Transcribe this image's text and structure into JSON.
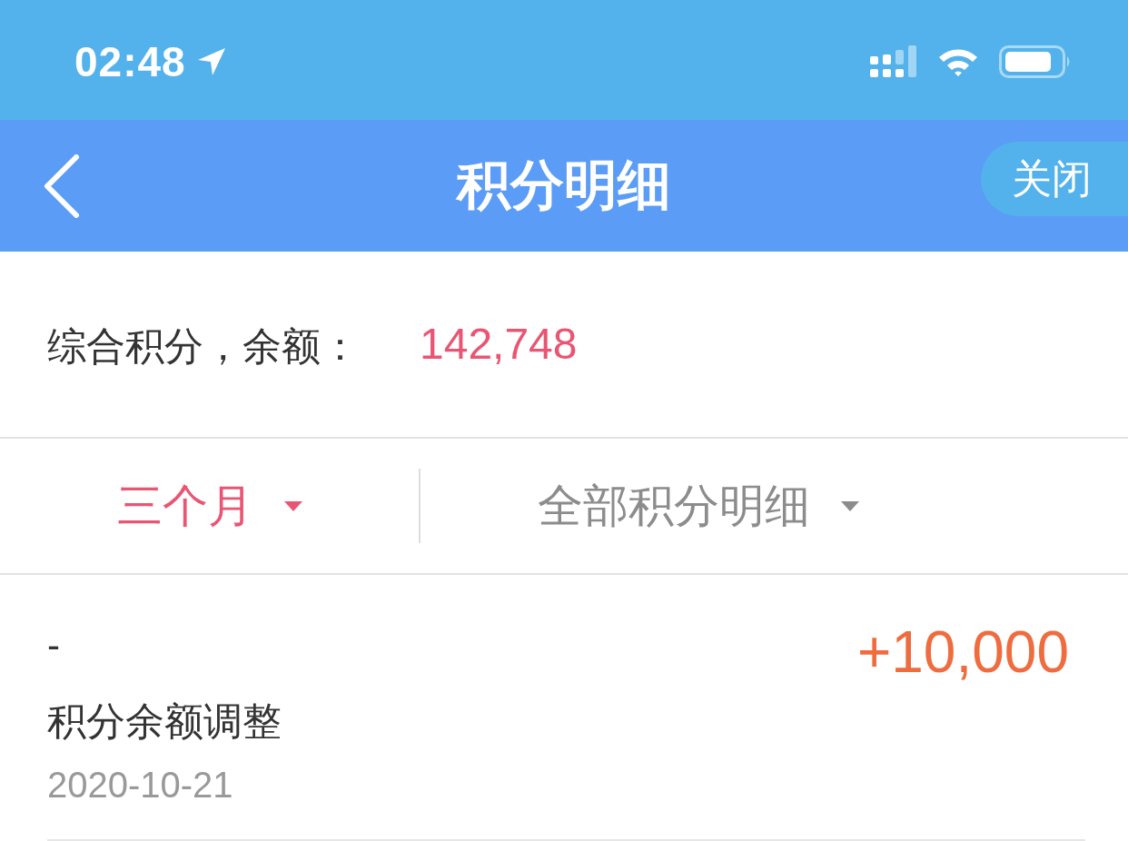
{
  "status_bar": {
    "time": "02:48"
  },
  "nav_bar": {
    "title": "积分明细",
    "close_button": "关闭"
  },
  "balance": {
    "label": "综合积分，余额：",
    "value": "142,748"
  },
  "filters": [
    {
      "label": "三个月",
      "selected": true
    },
    {
      "label": "全部积分明细",
      "selected": false
    }
  ],
  "records": [
    {
      "marker": "-",
      "amount": "+10,000",
      "title": "积分余额调整",
      "date": "2020-10-21"
    }
  ]
}
